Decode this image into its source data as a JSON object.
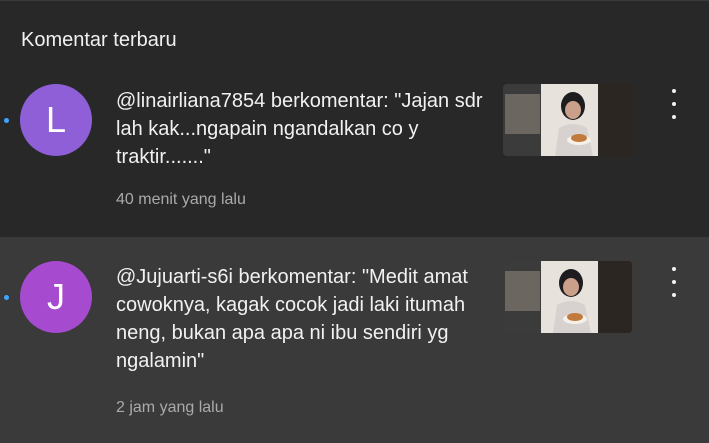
{
  "panel": {
    "title": "Komentar terbaru"
  },
  "notifications": [
    {
      "avatar_letter": "L",
      "text": "@linairliana7854 berkomentar: \"Jajan sdr lah kak...ngapain ngandalkan co y traktir.......\"",
      "time": "40 menit yang lalu",
      "avatar_color": "#8e5fd6"
    },
    {
      "avatar_letter": "J",
      "text": "@Jujuarti-s6i berkomentar: \"Medit amat cowoknya, kagak cocok jadi laki itumah neng, bukan apa apa ni ibu sendiri yg ngalamin\"",
      "time": "2 jam yang lalu",
      "avatar_color": "#a64bd0"
    }
  ],
  "colors": {
    "background": "#282828",
    "hover_background": "#3a3a3a",
    "unread_dot": "#3ea6ff",
    "secondary_text": "#aaaaaa"
  }
}
